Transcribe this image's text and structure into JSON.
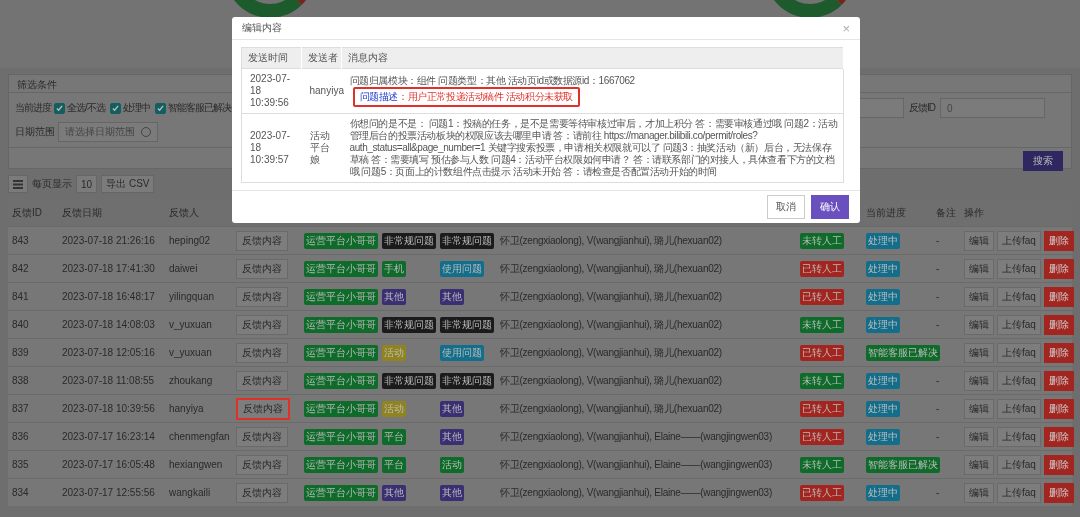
{
  "filter_panel": {
    "title": "筛选条件",
    "progress_label": "当前进度",
    "checkboxes": [
      {
        "label": "全选/不选",
        "checked": true
      },
      {
        "label": "处理中",
        "checked": true
      },
      {
        "label": "智能客服已解决",
        "checked": true
      }
    ],
    "date_label": "日期范围",
    "date_placeholder": "请选择日期范围",
    "id_label": "反馈ID",
    "id_value": "0",
    "search_button": "搜索"
  },
  "toolbar": {
    "page_size_label": "每页显示",
    "page_size": "10",
    "export_button": "导出 CSV"
  },
  "table": {
    "columns": [
      "反馈ID",
      "反馈日期",
      "反馈人",
      "",
      "",
      "",
      "",
      "",
      "",
      "当前进度",
      "备注",
      "操作"
    ],
    "rows": [
      {
        "id": "843",
        "date": "2023-07-18 21:26:16",
        "user": "heping02",
        "content_button": "反馈内容",
        "annotated": false,
        "tags": [
          {
            "label": "运营平台小哥哥",
            "color": "#0e6b2a"
          },
          {
            "label": "非常规问题",
            "color": "#1b1b1b"
          },
          {
            "label": "非常规问题",
            "color": "#1b1b1b"
          }
        ],
        "members": "怀卫(zengxiaolong), V(wangjianhui), 璐儿(hexuan02)",
        "status": {
          "label": "未转人工",
          "color": "#0e6b2a"
        },
        "progress": {
          "label": "处理中",
          "color": "#136e8c"
        },
        "remark": "-",
        "actions": [
          "编辑",
          "上传faq",
          "删除"
        ]
      },
      {
        "id": "842",
        "date": "2023-07-18 17:41:30",
        "user": "daiwei",
        "content_button": "反馈内容",
        "annotated": false,
        "tags": [
          {
            "label": "运营平台小哥哥",
            "color": "#0e6b2a"
          },
          {
            "label": "手机",
            "color": "#0e6b2a"
          },
          {
            "label": "使用问题",
            "color": "#136e8c"
          }
        ],
        "members": "怀卫(zengxiaolong), V(wangjianhui), 璐儿(hexuan02)",
        "status": {
          "label": "已转人工",
          "color": "#a32520"
        },
        "progress": {
          "label": "处理中",
          "color": "#136e8c"
        },
        "remark": "-",
        "actions": [
          "编辑",
          "上传faq",
          "删除"
        ]
      },
      {
        "id": "841",
        "date": "2023-07-18 16:48:17",
        "user": "yilingquan",
        "content_button": "反馈内容",
        "annotated": false,
        "tags": [
          {
            "label": "运营平台小哥哥",
            "color": "#0e6b2a"
          },
          {
            "label": "其他",
            "color": "#3a2f72"
          },
          {
            "label": "其他",
            "color": "#3a2f72"
          }
        ],
        "members": "怀卫(zengxiaolong), V(wangjianhui), 璐儿(hexuan02)",
        "status": {
          "label": "已转人工",
          "color": "#a32520"
        },
        "progress": {
          "label": "处理中",
          "color": "#136e8c"
        },
        "remark": "-",
        "actions": [
          "编辑",
          "上传faq",
          "删除"
        ]
      },
      {
        "id": "840",
        "date": "2023-07-18 14:08:03",
        "user": "v_yuxuan",
        "content_button": "反馈内容",
        "annotated": false,
        "tags": [
          {
            "label": "运营平台小哥哥",
            "color": "#0e6b2a"
          },
          {
            "label": "非常规问题",
            "color": "#1b1b1b"
          },
          {
            "label": "非常规问题",
            "color": "#1b1b1b"
          }
        ],
        "members": "怀卫(zengxiaolong), V(wangjianhui), 璐儿(hexuan02)",
        "status": {
          "label": "未转人工",
          "color": "#0e6b2a"
        },
        "progress": {
          "label": "处理中",
          "color": "#136e8c"
        },
        "remark": "-",
        "actions": [
          "编辑",
          "上传faq",
          "删除"
        ]
      },
      {
        "id": "839",
        "date": "2023-07-18 12:05:16",
        "user": "v_yuxuan",
        "content_button": "反馈内容",
        "annotated": false,
        "tags": [
          {
            "label": "运营平台小哥哥",
            "color": "#0e6b2a"
          },
          {
            "label": "活动",
            "color": "#8f8420"
          },
          {
            "label": "使用问题",
            "color": "#136e8c"
          }
        ],
        "members": "怀卫(zengxiaolong), V(wangjianhui), 璐儿(hexuan02)",
        "status": {
          "label": "已转人工",
          "color": "#a32520"
        },
        "progress": {
          "label": "智能客服已解决",
          "color": "#0e6b2a"
        },
        "remark": "-",
        "actions": [
          "编辑",
          "上传faq",
          "删除"
        ]
      },
      {
        "id": "838",
        "date": "2023-07-18 11:08:55",
        "user": "zhoukang",
        "content_button": "反馈内容",
        "annotated": false,
        "tags": [
          {
            "label": "运营平台小哥哥",
            "color": "#0e6b2a"
          },
          {
            "label": "非常规问题",
            "color": "#1b1b1b"
          },
          {
            "label": "非常规问题",
            "color": "#1b1b1b"
          }
        ],
        "members": "怀卫(zengxiaolong), V(wangjianhui), 璐儿(hexuan02)",
        "status": {
          "label": "未转人工",
          "color": "#0e6b2a"
        },
        "progress": {
          "label": "处理中",
          "color": "#136e8c"
        },
        "remark": "-",
        "actions": [
          "编辑",
          "上传faq",
          "删除"
        ]
      },
      {
        "id": "837",
        "date": "2023-07-18 10:39:56",
        "user": "hanyiya",
        "content_button": "反馈内容",
        "annotated": true,
        "tags": [
          {
            "label": "运营平台小哥哥",
            "color": "#0e6b2a"
          },
          {
            "label": "活动",
            "color": "#8f8420"
          },
          {
            "label": "其他",
            "color": "#3a2f72"
          }
        ],
        "members": "怀卫(zengxiaolong), V(wangjianhui), 璐儿(hexuan02)",
        "status": {
          "label": "已转人工",
          "color": "#a32520"
        },
        "progress": {
          "label": "处理中",
          "color": "#136e8c"
        },
        "remark": "-",
        "actions": [
          "编辑",
          "上传faq",
          "删除"
        ]
      },
      {
        "id": "836",
        "date": "2023-07-17 16:23:14",
        "user": "chenmengfan",
        "content_button": "反馈内容",
        "annotated": false,
        "tags": [
          {
            "label": "运营平台小哥哥",
            "color": "#0e6b2a"
          },
          {
            "label": "平台",
            "color": "#0e6b2a"
          },
          {
            "label": "其他",
            "color": "#3a2f72"
          }
        ],
        "members": "怀卫(zengxiaolong), V(wangjianhui), Elaine——(wangjingwen03)",
        "status": {
          "label": "已转人工",
          "color": "#a32520"
        },
        "progress": {
          "label": "处理中",
          "color": "#136e8c"
        },
        "remark": "-",
        "actions": [
          "编辑",
          "上传faq",
          "删除"
        ]
      },
      {
        "id": "835",
        "date": "2023-07-17 16:05:48",
        "user": "hexiangwen",
        "content_button": "反馈内容",
        "annotated": false,
        "tags": [
          {
            "label": "运营平台小哥哥",
            "color": "#0e6b2a"
          },
          {
            "label": "平台",
            "color": "#0e6b2a"
          },
          {
            "label": "活动",
            "color": "#0e6b2a"
          }
        ],
        "members": "怀卫(zengxiaolong), V(wangjianhui), Elaine——(wangjingwen03)",
        "status": {
          "label": "未转人工",
          "color": "#0e6b2a"
        },
        "progress": {
          "label": "智能客服已解决",
          "color": "#0e6b2a"
        },
        "remark": "-",
        "actions": [
          "编辑",
          "上传faq",
          "删除"
        ]
      },
      {
        "id": "834",
        "date": "2023-07-17 12:55:56",
        "user": "wangkaili",
        "content_button": "反馈内容",
        "annotated": false,
        "tags": [
          {
            "label": "运营平台小哥哥",
            "color": "#0e6b2a"
          },
          {
            "label": "其他",
            "color": "#3a2f72"
          },
          {
            "label": "其他",
            "color": "#3a2f72"
          }
        ],
        "members": "怀卫(zengxiaolong), V(wangjianhui), Elaine——(wangjingwen03)",
        "status": {
          "label": "已转人工",
          "color": "#a32520"
        },
        "progress": {
          "label": "处理中",
          "color": "#136e8c"
        },
        "remark": "-",
        "actions": [
          "编辑",
          "上传faq",
          "删除"
        ]
      }
    ]
  },
  "dialog": {
    "title": "编辑内容",
    "close": "×",
    "columns": [
      "发送时间",
      "发送者",
      "消息内容"
    ],
    "messages": [
      {
        "time": "2023-07-18 10:39:56",
        "sender": "hanyiya",
        "text": "问题归属模块：组件 问题类型：其他 活动页id或数据源id：1667062",
        "highlight_label": "问题描述",
        "highlight_text": "：用户正常投递活动稿件 活动积分未获取"
      },
      {
        "time": "2023-07-18 10:39:57",
        "sender": "活动平台娘",
        "text": "你想问的是不是： 问题1：投稿的任务，是不是需要等待审核过审后，才加上积分 答：需要审核通过哦 问题2：活动管理后台的投票活动板块的权限应该去哪里申请 答：请前往 https://manager.bilibili.co/permit/roles?auth_status=all&page_number=1 关键字搜索投票，申请相关权限就可以了 问题3：抽奖活动（新）后台，无法保存草稿 答：需要填写 预估参与人数 问题4：活动平台权限如何申请？ 答：请联系部门的对接人，具体查看下方的文档哦 问题5：页面上的计数组件点击提示 活动未开始 答：请检查是否配置活动开始的时间"
      }
    ],
    "buttons": [
      {
        "label": "取消",
        "kind": "secondary"
      },
      {
        "label": "确认",
        "kind": "primary"
      }
    ]
  }
}
